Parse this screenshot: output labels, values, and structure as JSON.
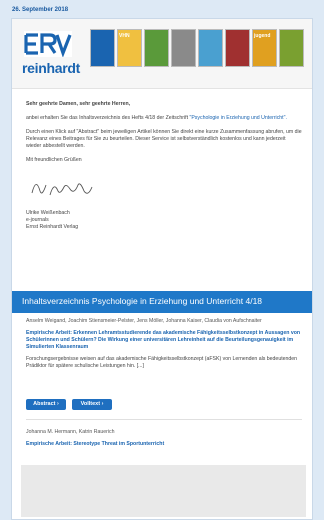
{
  "date": "26. September 2018",
  "brand": {
    "logo_text": "reinhardt",
    "logo_mark": "ERV"
  },
  "covers": [
    {
      "label": "",
      "color": "#1a64b0"
    },
    {
      "label": "VHN",
      "color": "#f0c040"
    },
    {
      "label": "",
      "color": "#5a9a3a"
    },
    {
      "label": "",
      "color": "#8a8a8a"
    },
    {
      "label": "",
      "color": "#4aa0d0"
    },
    {
      "label": "",
      "color": "#a03030"
    },
    {
      "label": "jugend",
      "color": "#e0a020"
    },
    {
      "label": "",
      "color": "#7aa030"
    }
  ],
  "letter": {
    "greeting": "Sehr geehrte Damen, sehr geehrte Herren,",
    "p1_a": "anbei erhalten Sie das Inhaltsverzeichnis des Hefts 4/18 der Zeitschrift ",
    "p1_link": "\"Psychologie in Erziehung und Unterricht\".",
    "p2": "Durch einen Klick auf \"Abstract\" beim jeweiligen Artikel können Sie direkt eine kurze Zusammenfassung abrufen, um die Relevanz eines Beitrages für Sie zu beurteilen. Dieser Service ist selbstverständlich kostenlos und kann jederzeit wieder abbestellt werden.",
    "closing": "Mit freundlichen Grüßen",
    "sender_name": "Ulrike Weißenbach",
    "sender_role": "e-journals",
    "sender_org": "Ernst Reinhardt Verlag"
  },
  "toc_title": "Inhaltsverzeichnis Psychologie in Erziehung und Unterricht 4/18",
  "articles": [
    {
      "authors": "Anselm Weigand, Joachim Stiensmeier-Pelster, Jens Möller, Johanna Kaiser, Claudia von Aufschnaiter",
      "title": "Empirische Arbeit: Erkennen Lehramtsstudierende das akademische Fähigkeitsselbstkonzept in Aussagen von Schülerinnen und Schülern? Die Wirkung einer universitären Lehreinheit auf die Beurteilungsgenauigkeit im Simulierten Klassenraum",
      "abstract": "Forschungsergebnisse weisen auf das akademische Fähigkeitsselbstkonzept (aFSK) von Lernenden als bedeutenden Prädiktor für spätere schulische Leistungen hin. [...]"
    },
    {
      "authors": "Johanna M. Hermann, Katrin Rauerich",
      "title": "Empirische Arbeit: Stereotype Threat im Sportunterricht",
      "abstract": ""
    }
  ],
  "buttons": {
    "abstract": "Abstract ›",
    "volltext": "Volltext ›"
  }
}
